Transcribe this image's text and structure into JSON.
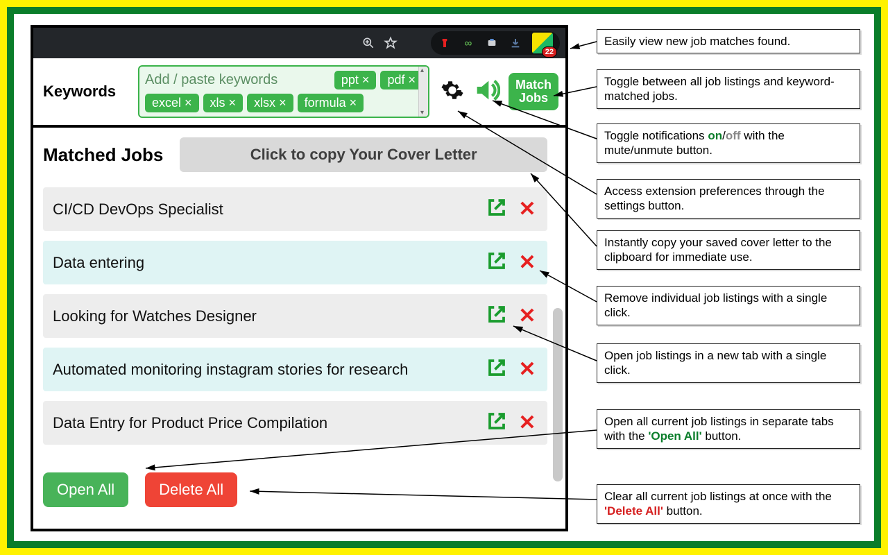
{
  "browser": {
    "badge_count": "22"
  },
  "keywords": {
    "label": "Keywords",
    "placeholder": "Add / paste keywords",
    "tags_row1": [
      "ppt",
      "pdf"
    ],
    "tags_row2": [
      "excel",
      "xls",
      "xlsx",
      "formula"
    ],
    "match_button": "Match\nJobs"
  },
  "matched": {
    "title": "Matched Jobs",
    "cover_button": "Click to copy Your Cover Letter",
    "jobs": [
      "CI/CD DevOps Specialist",
      "Data entering",
      "Looking for Watches Designer",
      "Automated monitoring instagram stories for research",
      "Data Entry for Product Price Compilation"
    ],
    "open_all": "Open All",
    "delete_all": "Delete All"
  },
  "callouts": {
    "c1": "Easily view new job matches found.",
    "c2": "Toggle between all job listings and keyword-matched jobs.",
    "c3_a": "Toggle notifications ",
    "c3_on": "on",
    "c3_sep": "/",
    "c3_off": "off",
    "c3_b": " with the mute/unmute button.",
    "c4": "Access extension preferences through the settings button.",
    "c5": "Instantly copy your saved cover letter to the clipboard for immediate use.",
    "c6": "Remove individual job listings with a single click.",
    "c7": "Open job listings in a new tab with a single click.",
    "c8_a": "Open all current job listings in separate tabs with the ",
    "c8_oa": "'Open All'",
    "c8_b": " button.",
    "c9_a": "Clear all current job listings at once with the ",
    "c9_da": "'Delete All'",
    "c9_b": " button."
  }
}
